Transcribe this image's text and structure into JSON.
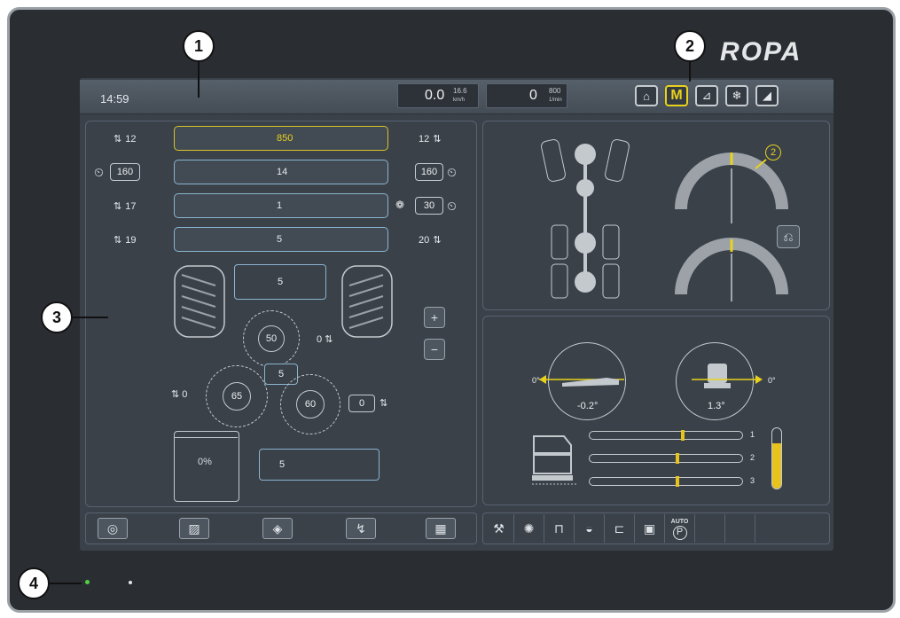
{
  "brand": "ROPA",
  "topbar": {
    "time": "14:59",
    "speed_value": "0.0",
    "speed_limit": "16.6",
    "speed_unit": "km/h",
    "rpm_value": "0",
    "rpm_limit": "800",
    "rpm_unit": "1/min",
    "buttons": [
      {
        "name": "home-icon",
        "glyph": "⌂",
        "active": false
      },
      {
        "name": "manual-mode-icon",
        "glyph": "M",
        "active": true
      },
      {
        "name": "seat-icon",
        "glyph": "⊿",
        "active": false
      },
      {
        "name": "climate-snowflake-icon",
        "glyph": "❄",
        "active": false
      },
      {
        "name": "wiper-icon",
        "glyph": "◢",
        "active": false
      }
    ]
  },
  "left_panel": {
    "rows": [
      {
        "left": "12",
        "value": "850",
        "right": "12"
      },
      {
        "left": "160",
        "value": "14",
        "right": "160"
      },
      {
        "left": "17",
        "value": "1",
        "right": "30"
      },
      {
        "left": "19",
        "value": "5",
        "right": "20"
      }
    ],
    "hopper_value": "5",
    "rollers": {
      "top": "50",
      "left": "65",
      "right": "60",
      "middle": "5"
    },
    "roller_top_side": "0",
    "roller_left_side": "0",
    "roller_right_box": "0",
    "tank_percent": "0%",
    "conveyor_value": "5",
    "plus": "+",
    "minus": "−"
  },
  "right_top": {
    "gauge_marker": "2"
  },
  "right_bottom": {
    "left_angle": "-0.2°",
    "left_zero": "0°",
    "right_angle": "1.3°",
    "right_zero": "0°",
    "sliders": [
      {
        "label": "1",
        "level": 0.62
      },
      {
        "label": "2",
        "level": 0.58
      },
      {
        "label": "3",
        "level": 0.58
      }
    ],
    "level_bar": 0.75
  },
  "bottom_left_buttons": [
    {
      "name": "steering-wheel-icon",
      "glyph": "◎"
    },
    {
      "name": "camera-off-icon",
      "glyph": "▨"
    },
    {
      "name": "nozzle-icon",
      "glyph": "◈"
    },
    {
      "name": "hand-lever-icon",
      "glyph": "↯"
    },
    {
      "name": "grid-menu-icon",
      "glyph": "▦"
    }
  ],
  "bottom_right_strip": [
    {
      "name": "topper-icon",
      "glyph": "⚒"
    },
    {
      "name": "scrubber-icon",
      "glyph": "✺"
    },
    {
      "name": "lift-icon",
      "glyph": "⊓"
    },
    {
      "name": "turtle-speed-icon",
      "glyph": "◒"
    },
    {
      "name": "unloader-icon",
      "glyph": "⊏"
    },
    {
      "name": "cab-icon",
      "glyph": "▣"
    },
    {
      "name": "auto-park-icon",
      "glyph": "P",
      "label": "AUTO"
    }
  ],
  "callouts": [
    "1",
    "2",
    "3",
    "4"
  ]
}
